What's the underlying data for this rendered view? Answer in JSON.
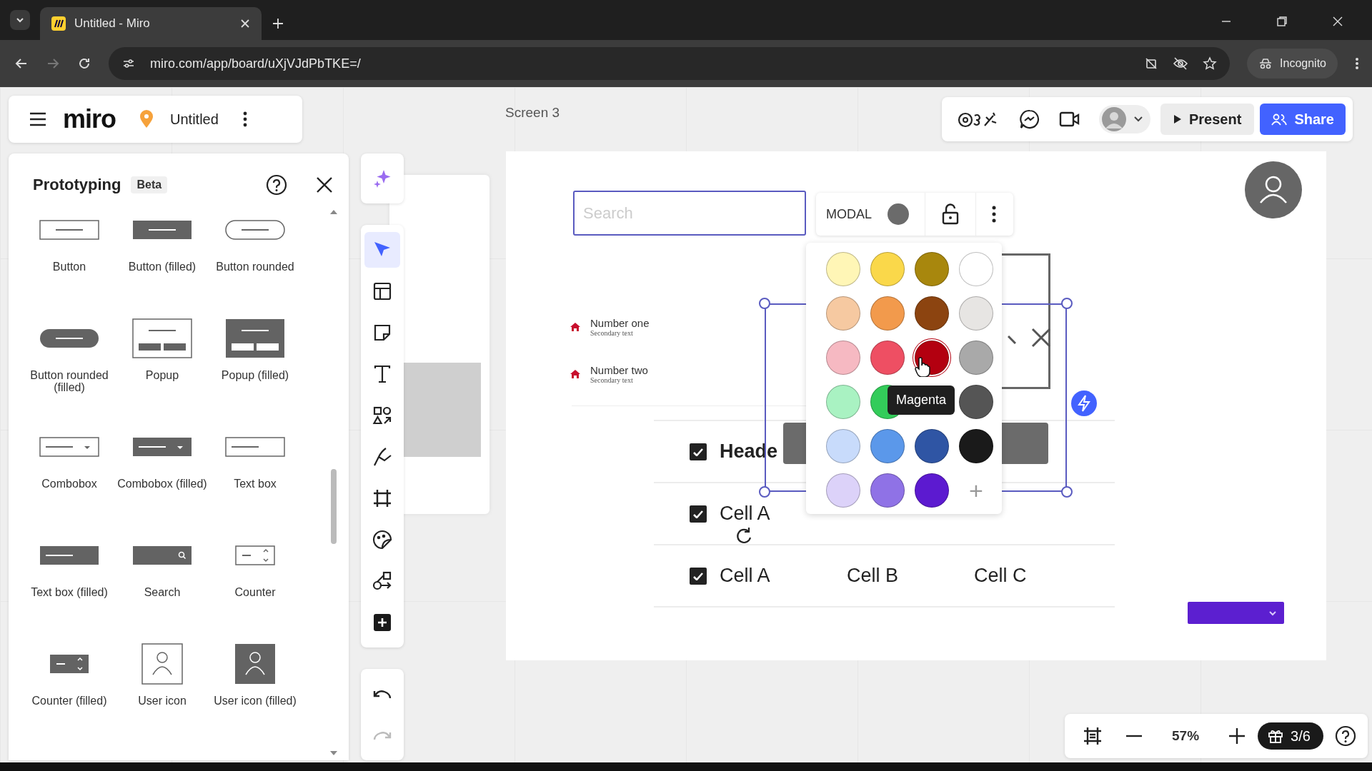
{
  "browser": {
    "tab": {
      "title": "Untitled - Miro",
      "selected": true
    },
    "url": "miro.com/app/board/uXjVJdPbTKE=/",
    "profile": "Incognito"
  },
  "board_header": {
    "logo": "miro",
    "board_name": "Untitled"
  },
  "frame_label": "Screen 3",
  "top_toolbar": {
    "present": "Present",
    "share": "Share"
  },
  "panel": {
    "title": "Prototyping",
    "badge": "Beta",
    "items": [
      {
        "kind": "button",
        "label": "Button"
      },
      {
        "kind": "button-filled",
        "label": "Button (filled)"
      },
      {
        "kind": "button-rounded",
        "label": "Button rounded"
      },
      {
        "kind": "button-rounded-filled",
        "label": "Button rounded (filled)"
      },
      {
        "kind": "popup",
        "label": "Popup"
      },
      {
        "kind": "popup-filled",
        "label": "Popup (filled)"
      },
      {
        "kind": "combobox",
        "label": "Combobox"
      },
      {
        "kind": "combobox-filled",
        "label": "Combobox (filled)"
      },
      {
        "kind": "textbox",
        "label": "Text box"
      },
      {
        "kind": "textbox-filled",
        "label": "Text box (filled)"
      },
      {
        "kind": "search",
        "label": "Search"
      },
      {
        "kind": "counter",
        "label": "Counter"
      },
      {
        "kind": "counter-filled",
        "label": "Counter (filled)"
      },
      {
        "kind": "user",
        "label": "User icon"
      },
      {
        "kind": "user-filled",
        "label": "User icon (filled)"
      }
    ]
  },
  "tools": [
    {
      "kind": "sparkle",
      "selected": false
    },
    {
      "kind": "pointer",
      "selected": true
    },
    {
      "kind": "template",
      "selected": false
    },
    {
      "kind": "sticky",
      "selected": false
    },
    {
      "kind": "text",
      "selected": false
    },
    {
      "kind": "shapes",
      "selected": false
    },
    {
      "kind": "pen",
      "selected": false
    },
    {
      "kind": "frame",
      "selected": false
    },
    {
      "kind": "sticker",
      "selected": false
    },
    {
      "kind": "diagram",
      "selected": false
    },
    {
      "kind": "add",
      "selected": false
    }
  ],
  "history": [
    {
      "kind": "undo",
      "disabled": false
    },
    {
      "kind": "redo",
      "disabled": true
    }
  ],
  "canvas": {
    "search": {
      "placeholder": "Search"
    },
    "modal_toolbar": {
      "label": "MODAL",
      "color": "#6b6b6b"
    },
    "list": [
      {
        "title": "Number one",
        "subtitle": "Secondary text"
      },
      {
        "title": "Number two",
        "subtitle": "Secondary text"
      }
    ],
    "table": {
      "rows": [
        {
          "kind": "header",
          "checked": true,
          "cells": [
            "Heade"
          ]
        },
        {
          "kind": "body",
          "checked": true,
          "cells": [
            "Cell A"
          ]
        },
        {
          "kind": "body",
          "checked": true,
          "cells": [
            "Cell A",
            "Cell B",
            "Cell C"
          ]
        }
      ]
    },
    "palette": {
      "tooltip": "Magenta",
      "swatches": [
        {
          "kind": "swatch",
          "color": "#fff6b6",
          "selected": false
        },
        {
          "kind": "swatch",
          "color": "#fad84a",
          "selected": false
        },
        {
          "kind": "swatch",
          "color": "#a8870d",
          "selected": false
        },
        {
          "kind": "swatch",
          "color": "#ffffff",
          "selected": false
        },
        {
          "kind": "swatch",
          "color": "#f6c9a1",
          "selected": false
        },
        {
          "kind": "swatch",
          "color": "#f29a4c",
          "selected": false
        },
        {
          "kind": "swatch",
          "color": "#8c4410",
          "selected": false
        },
        {
          "kind": "swatch",
          "color": "#e7e5e3",
          "selected": false
        },
        {
          "kind": "swatch",
          "color": "#f6b9c2",
          "selected": false
        },
        {
          "kind": "swatch",
          "color": "#ee4f63",
          "selected": false
        },
        {
          "kind": "swatch",
          "color": "#b30010",
          "selected": true
        },
        {
          "kind": "swatch",
          "color": "#a9a9a9",
          "selected": false
        },
        {
          "kind": "swatch",
          "color": "#a9f2c2",
          "selected": false
        },
        {
          "kind": "swatch",
          "color": "#33cc5a",
          "selected": false
        },
        {
          "kind": "covered"
        },
        {
          "kind": "swatch",
          "color": "#555555",
          "selected": false
        },
        {
          "kind": "swatch",
          "color": "#c8dbfb",
          "selected": false
        },
        {
          "kind": "swatch",
          "color": "#5b98ea",
          "selected": false
        },
        {
          "kind": "swatch",
          "color": "#2f55a4",
          "selected": false
        },
        {
          "kind": "swatch",
          "color": "#1a1a1a",
          "selected": false
        },
        {
          "kind": "swatch",
          "color": "#dcd2f9",
          "selected": false
        },
        {
          "kind": "swatch",
          "color": "#8f72e6",
          "selected": false
        },
        {
          "kind": "swatch",
          "color": "#5c1ad0",
          "selected": false
        },
        {
          "kind": "add",
          "text": "+"
        }
      ]
    }
  },
  "zoom": {
    "value": "57%",
    "onboarding": "3/6"
  }
}
